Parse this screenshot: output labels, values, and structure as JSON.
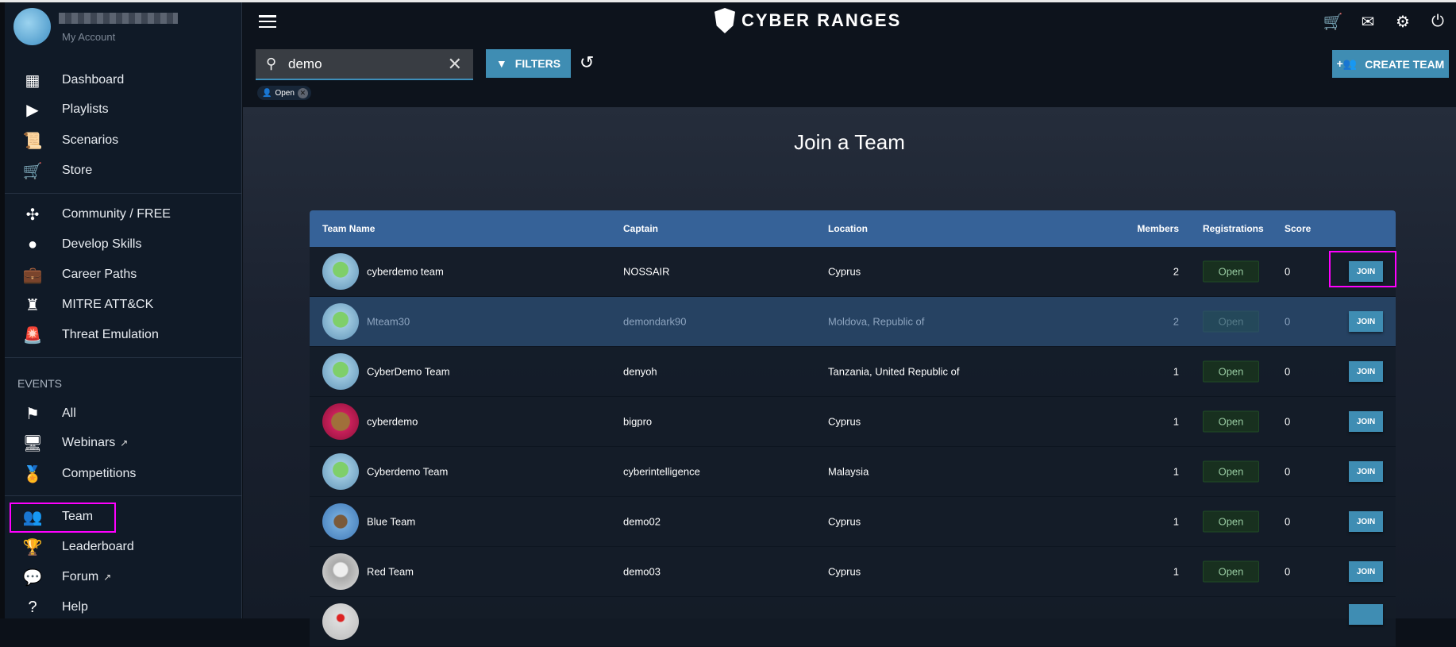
{
  "account": {
    "label": "My Account"
  },
  "nav": {
    "main": [
      {
        "label": "Dashboard",
        "icon": "dashboard-icon"
      },
      {
        "label": "Playlists",
        "icon": "playlist-icon"
      },
      {
        "label": "Scenarios",
        "icon": "scenario-icon"
      },
      {
        "label": "Store",
        "icon": "cart-icon"
      }
    ],
    "learn": [
      {
        "label": "Community / FREE",
        "icon": "community-icon"
      },
      {
        "label": "Develop Skills",
        "icon": "brain-icon"
      },
      {
        "label": "Career Paths",
        "icon": "briefcase-icon"
      },
      {
        "label": "MITRE ATT&CK",
        "icon": "chess-rook-icon"
      },
      {
        "label": "Threat Emulation",
        "icon": "siren-icon"
      }
    ],
    "events_heading": "EVENTS",
    "events": [
      {
        "label": "All",
        "icon": "checkered-flag-icon"
      },
      {
        "label": "Webinars",
        "icon": "presentation-icon"
      },
      {
        "label": "Competitions",
        "icon": "medal-icon"
      }
    ],
    "bottom": [
      {
        "label": "Team",
        "icon": "team-icon"
      },
      {
        "label": "Leaderboard",
        "icon": "trophy-icon"
      },
      {
        "label": "Forum",
        "icon": "forum-icon"
      },
      {
        "label": "Help",
        "icon": "help-icon"
      }
    ]
  },
  "header": {
    "logo": "CYBER RANGES"
  },
  "search": {
    "value": "demo"
  },
  "filters_label": "FILTERS",
  "chip_label": "Open",
  "create_team_label": "CREATE TEAM",
  "page_title": "Join a Team",
  "table": {
    "columns": [
      "Team Name",
      "Captain",
      "Location",
      "Members",
      "Registrations",
      "Score"
    ],
    "join_label": "JOIN",
    "rows": [
      {
        "name": "cyberdemo team",
        "captain": "NOSSAIR",
        "location": "Cyprus",
        "members": "2",
        "registrations": "Open",
        "score": "0",
        "avatar": "alien"
      },
      {
        "name": "Mteam30",
        "captain": "demondark90",
        "location": "Moldova, Republic of",
        "members": "2",
        "registrations": "Open",
        "score": "0",
        "avatar": "alien"
      },
      {
        "name": "CyberDemo Team",
        "captain": "denyoh",
        "location": "Tanzania, United Republic of",
        "members": "1",
        "registrations": "Open",
        "score": "0",
        "avatar": "alien"
      },
      {
        "name": "cyberdemo",
        "captain": "bigpro",
        "location": "Cyprus",
        "members": "1",
        "registrations": "Open",
        "score": "0",
        "avatar": "lion"
      },
      {
        "name": "Cyberdemo Team",
        "captain": "cyberintelligence",
        "location": "Malaysia",
        "members": "1",
        "registrations": "Open",
        "score": "0",
        "avatar": "alien"
      },
      {
        "name": "Blue Team",
        "captain": "demo02",
        "location": "Cyprus",
        "members": "1",
        "registrations": "Open",
        "score": "0",
        "avatar": "tower"
      },
      {
        "name": "Red Team",
        "captain": "demo03",
        "location": "Cyprus",
        "members": "1",
        "registrations": "Open",
        "score": "0",
        "avatar": "skull"
      }
    ]
  }
}
